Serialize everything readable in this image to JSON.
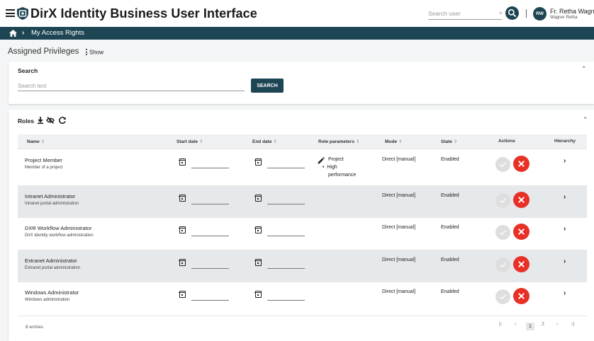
{
  "header": {
    "title": "DirX Identity Business User Interface",
    "search_placeholder": "Search user",
    "clear": "×",
    "user_initials": "RW",
    "user_name": "Fr. Retha Wagne",
    "user_sub": "Wagner Retha"
  },
  "breadcrumb": {
    "separator": "›",
    "current": "My Access Rights"
  },
  "page": {
    "title": "Assigned Privileges",
    "show_label": "Show"
  },
  "search": {
    "title": "Search",
    "placeholder": "Search text",
    "button": "SEARCH",
    "collapse": "⌃"
  },
  "roles": {
    "title": "Roles",
    "collapse": "⌃",
    "columns": {
      "name": "Name",
      "start": "Start date",
      "end": "End date",
      "params": "Role parameters",
      "mode": "Mode",
      "state": "State",
      "actions": "Actions",
      "hierarchy": "Hierarchy"
    },
    "sort_glyph": "⇕",
    "rows": [
      {
        "name": "Project Member",
        "desc": "Member of a project",
        "mode": "Direct [manual]",
        "state": "Enabled",
        "param_title": "Project",
        "param_bullet": "•",
        "param_value_1": "High",
        "param_value_2": "performance",
        "hier": "›"
      },
      {
        "name": "Intranet Administrator",
        "desc": "Intranet portal administration",
        "mode": "Direct [manual]",
        "state": "Enabled",
        "hier": "›"
      },
      {
        "name": "DXR Workflow Administrator",
        "desc": "DirX Identity workflow administration",
        "mode": "Direct [manual]",
        "state": "Enabled",
        "hier": "›"
      },
      {
        "name": "Extranet Administrator",
        "desc": "Extranet portal administration",
        "mode": "Direct [manual]",
        "state": "Enabled",
        "hier": "›"
      },
      {
        "name": "Windows Administrator",
        "desc": "Windows administration",
        "mode": "Direct [manual]",
        "state": "Enabled",
        "hier": "›"
      }
    ],
    "entries": "8 entries",
    "pager": {
      "first": "|‹",
      "prev": "‹",
      "page1": "1",
      "page2": "2",
      "next": "›",
      "last": "›|"
    }
  },
  "colors": {
    "primary": "#1e4554",
    "danger": "#e83027",
    "row_shade": "#e6e9eb"
  }
}
